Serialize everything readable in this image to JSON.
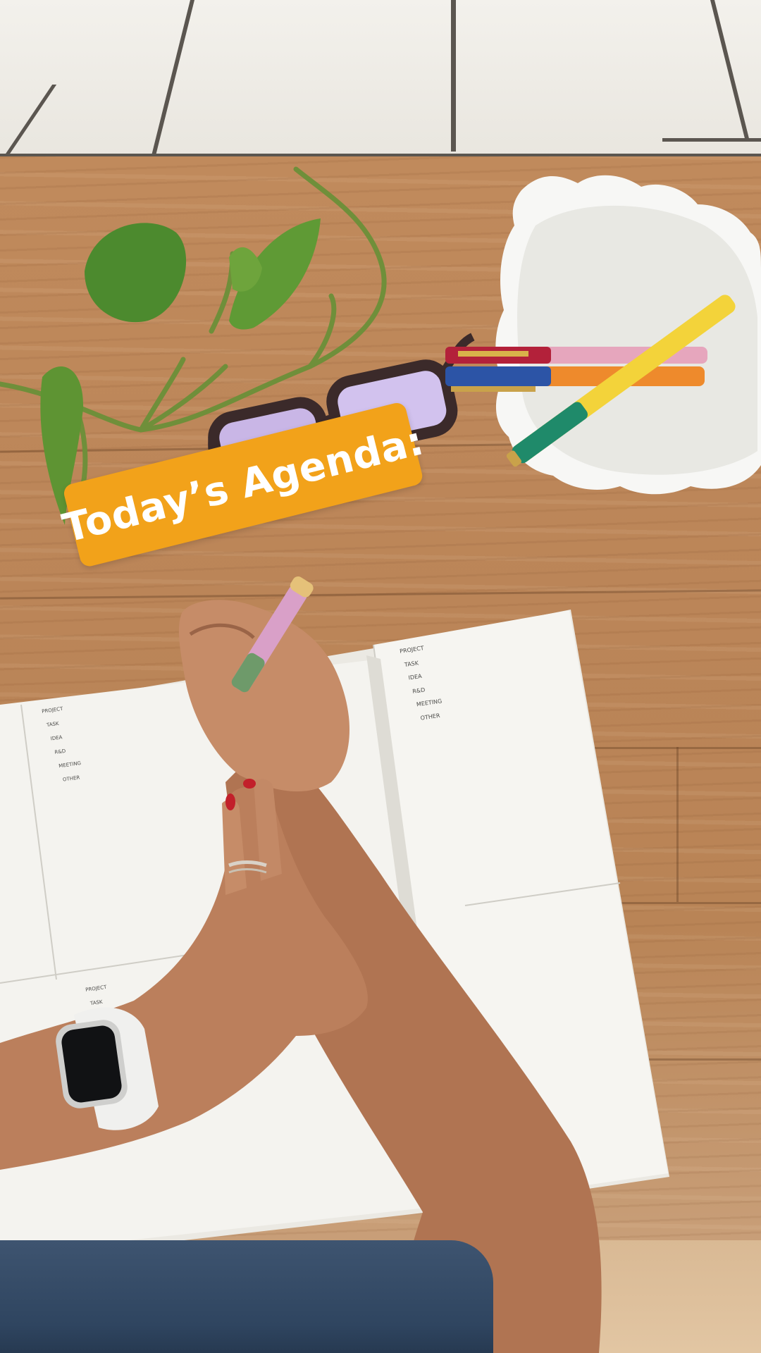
{
  "overlay": {
    "banner_text": "Today’s Agenda:",
    "banner_color": "#f2a21a",
    "text_color": "#ffffff"
  },
  "planner": {
    "right_page_labels": [
      "PROJECT",
      "TASK",
      "IDEA",
      "R&D",
      "MEETING",
      "OTHER"
    ],
    "left_page_labels": [
      "PROJECT",
      "TASK",
      "IDEA",
      "R&D",
      "MEETING",
      "OTHER"
    ],
    "lower_page_labels": [
      "PROJECT",
      "TASK"
    ]
  },
  "scene_objects": [
    "tile-wall",
    "wood-table",
    "pothos-plant",
    "eyeglasses",
    "white-shell-cup",
    "pens",
    "open-planner",
    "hand-with-pen",
    "smartwatch",
    "jeans"
  ]
}
